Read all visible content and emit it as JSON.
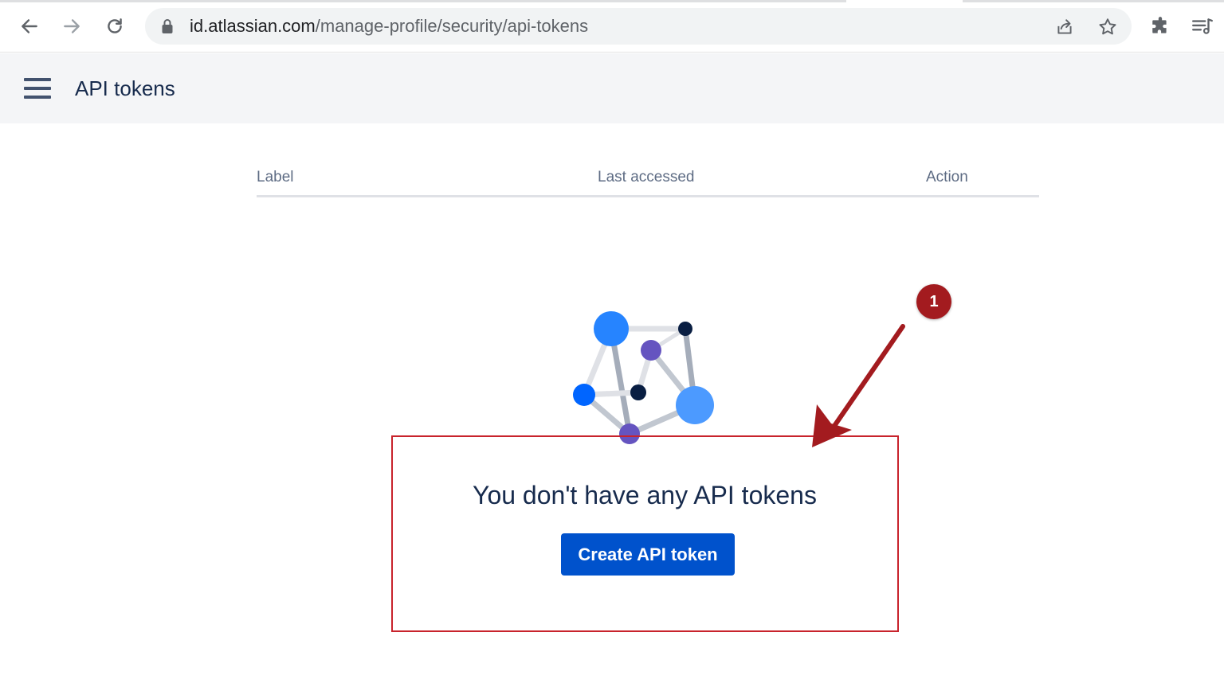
{
  "browser": {
    "url_host": "id.atlassian.com",
    "url_path": "/manage-profile/security/api-tokens",
    "icons": [
      "back-icon",
      "forward-icon",
      "reload-icon",
      "lock-icon",
      "share-icon",
      "bookmark-star-icon",
      "extensions-puzzle-icon",
      "reading-list-icon"
    ]
  },
  "header": {
    "title": "API tokens",
    "menu_icon": "hamburger-menu-icon"
  },
  "table": {
    "columns": [
      "Label",
      "Last accessed",
      "Action"
    ]
  },
  "empty_state": {
    "illustration": "network-molecule-illustration",
    "title": "You don't have any API tokens",
    "button_label": "Create API token"
  },
  "annotation": {
    "step_number": "1",
    "color": "#a31b1f"
  },
  "colors": {
    "primary_button": "#0052cc",
    "header_bg": "#f4f5f7",
    "text": "#172b4d"
  }
}
